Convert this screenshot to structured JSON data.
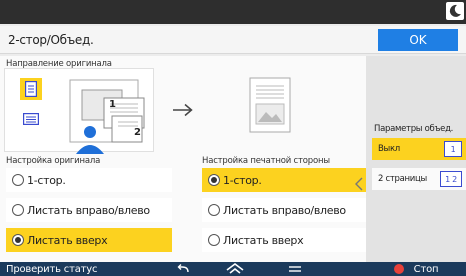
{
  "header": {
    "title": "2-стор/Объед.",
    "ok_label": "OK"
  },
  "orientation": {
    "label": "Направление оригинала",
    "page_numbers": [
      "1",
      "2"
    ]
  },
  "original_setting": {
    "label": "Настройка оригинала",
    "options": [
      {
        "label": "1-стор.",
        "selected": false
      },
      {
        "label": "Листать вправо/влево",
        "selected": false
      },
      {
        "label": "Листать вверх",
        "selected": true
      }
    ]
  },
  "print_side_setting": {
    "label": "Настройка печатной стороны",
    "options": [
      {
        "label": "1-стор.",
        "selected": true
      },
      {
        "label": "Листать вправо/влево",
        "selected": false
      },
      {
        "label": "Листать вверх",
        "selected": false
      }
    ]
  },
  "combine": {
    "label": "Параметры объед.",
    "items": [
      {
        "label": "Выкл",
        "icon_text": "1",
        "selected": true
      },
      {
        "label": "2 страницы",
        "icon_text": "1 2",
        "selected": false
      }
    ]
  },
  "bottom": {
    "status_label": "Проверить статус",
    "stop_label": "Стоп"
  },
  "colors": {
    "accent": "#1f7fe4",
    "selected": "#fcd21f",
    "bottom_bar": "#1b3a5c",
    "stop": "#e8413a"
  }
}
